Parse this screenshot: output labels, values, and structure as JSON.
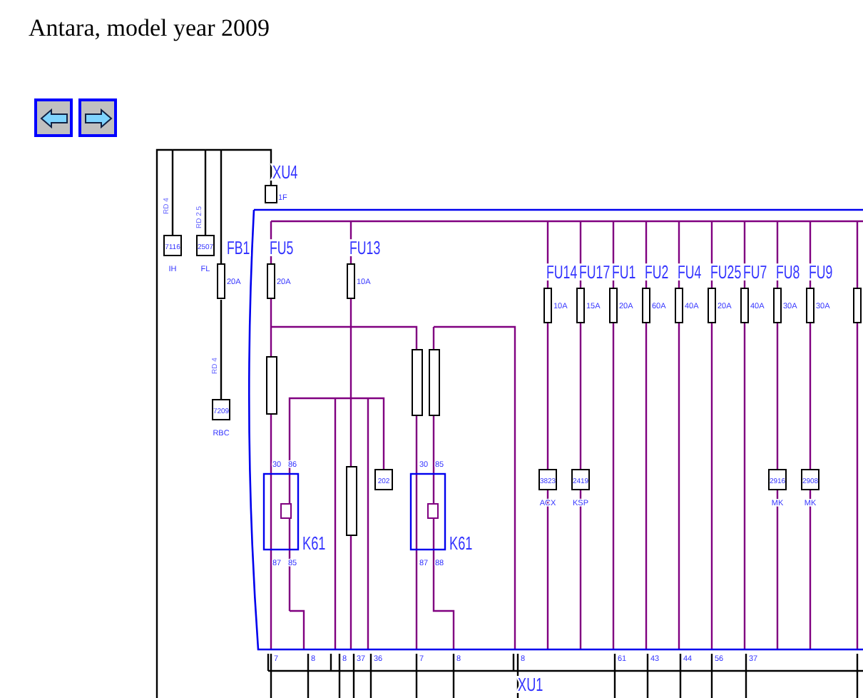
{
  "page_title": "Antara, model year 2009",
  "diagram": {
    "top_connector": {
      "name": "XU4",
      "pin": "1F"
    },
    "bottom_connector": {
      "name": "XU1"
    },
    "wire_specs": [
      "RD 4",
      "RD 2.5",
      "RD 4"
    ],
    "fuses": [
      {
        "name": "FB1",
        "rating": "20A"
      },
      {
        "name": "FU5",
        "rating": "20A"
      },
      {
        "name": "FU13",
        "rating": "10A"
      },
      {
        "name": "FU14",
        "rating": "10A"
      },
      {
        "name": "FU17",
        "rating": "15A"
      },
      {
        "name": "FU1",
        "rating": "20A"
      },
      {
        "name": "FU2",
        "rating": "60A"
      },
      {
        "name": "FU4",
        "rating": "40A"
      },
      {
        "name": "FU25",
        "rating": "20A"
      },
      {
        "name": "FU7",
        "rating": "40A"
      },
      {
        "name": "FU8",
        "rating": "30A"
      },
      {
        "name": "FU9",
        "rating": "30A"
      }
    ],
    "connectors": [
      {
        "code": "7116",
        "label": "IH"
      },
      {
        "code": "2507",
        "label": "FL"
      },
      {
        "code": "7209",
        "label": "RBC"
      },
      {
        "code": "202"
      },
      {
        "code": "3823",
        "label": "ACX"
      },
      {
        "code": "2419",
        "label": "KSP"
      },
      {
        "code": "2916",
        "label": "MK"
      },
      {
        "code": "2908",
        "label": "MK"
      }
    ],
    "relays": [
      {
        "name": "K61",
        "pins": [
          "30",
          "86",
          "87",
          "85"
        ]
      },
      {
        "name": "K61",
        "pins": [
          "30",
          "85",
          "87",
          "88"
        ]
      }
    ],
    "terminals": [
      "7",
      "8",
      "8",
      "37",
      "36",
      "7",
      "8",
      "8",
      "61",
      "43",
      "44",
      "56",
      "37"
    ]
  }
}
